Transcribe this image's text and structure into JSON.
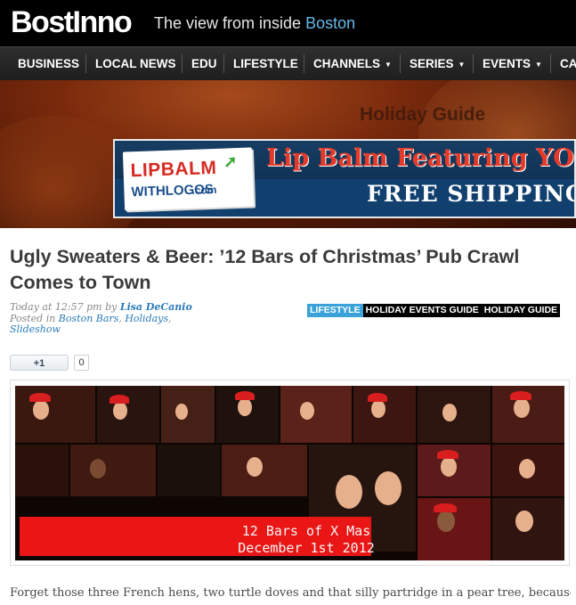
{
  "brand": {
    "logo": "BostInno",
    "tagline_prefix": "The view from inside",
    "tagline_city": "Boston"
  },
  "nav": {
    "items": [
      {
        "label": "BUSINESS",
        "has_caret": false
      },
      {
        "label": "LOCAL NEWS",
        "has_caret": false
      },
      {
        "label": "EDU",
        "has_caret": false
      },
      {
        "label": "LIFESTYLE",
        "has_caret": false
      },
      {
        "label": "CHANNELS",
        "has_caret": true
      },
      {
        "label": "SERIES",
        "has_caret": true
      },
      {
        "label": "EVENTS",
        "has_caret": true
      },
      {
        "label": "CA",
        "has_caret": false
      }
    ]
  },
  "banner": {
    "title": "Holiday Guide"
  },
  "ad": {
    "logo_line1": "LIPBALM",
    "logo_line2": "WITHLOGOS",
    "logo_suffix": ".com",
    "slogan": "Lip Balm Featuring YO",
    "shipping": "FREE SHIPPING"
  },
  "article": {
    "title": "Ugly Sweaters & Beer: ’12 Bars of Christmas’ Pub Crawl Comes to Town",
    "time": "Today at 12:57 pm",
    "by": "by",
    "author": "Lisa DeCanio",
    "posted_in_label": "Posted in",
    "categories": [
      "Boston Bars",
      "Holidays",
      "Slideshow"
    ],
    "tags": [
      {
        "label": "LIFESTYLE",
        "style": "blue"
      },
      {
        "label": "HOLIDAY EVENTS GUIDE",
        "style": "black"
      },
      {
        "label": "HOLIDAY GUIDE",
        "style": "black"
      }
    ],
    "plusone_label": "+1",
    "plusone_count": "0",
    "image_caption_line1": "12 Bars of X Mas",
    "image_caption_line2": "December 1st 2012",
    "body_first_line": "Forget those three French hens, two turtle doves and that silly partridge in a pear tree, because"
  },
  "colors": {
    "nav_bg": "#262626",
    "link": "#2a7bb8",
    "tag_blue": "#3aa2d8",
    "caption_red": "#ea1515"
  }
}
